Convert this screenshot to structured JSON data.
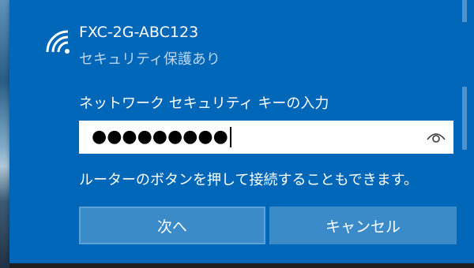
{
  "network": {
    "name": "FXC-2G-ABC123",
    "status": "セキュリティ保護あり",
    "icon": "wifi-icon"
  },
  "password": {
    "label": "ネットワーク セキュリティ キーの入力",
    "masked_value": "●●●●●●●●●",
    "reveal_icon": "eye-icon"
  },
  "hint": "ルーターのボタンを押して接続することもできます。",
  "buttons": {
    "next": "次へ",
    "cancel": "キャンセル"
  },
  "colors": {
    "flyout_background": "#0067b8",
    "button_background": "#3c8bc9",
    "secondary_text": "#b9d6ee"
  }
}
